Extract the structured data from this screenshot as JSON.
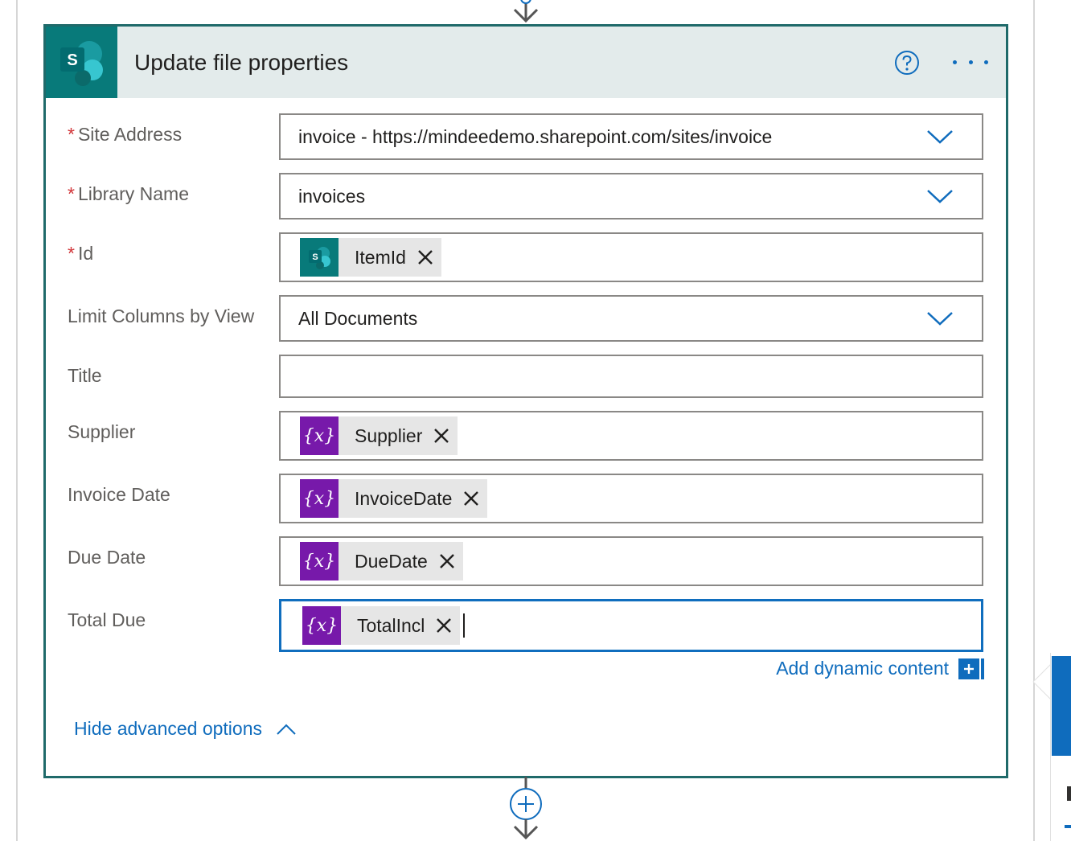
{
  "card": {
    "title": "Update file properties",
    "help_icon": "question-circle-icon",
    "more_icon": "ellipsis-icon",
    "logo_icon": "sharepoint-logo-icon"
  },
  "fields": {
    "site_address": {
      "label": "Site Address",
      "required": true,
      "value": "invoice - https://mindeedemo.sharepoint.com/sites/invoice"
    },
    "library_name": {
      "label": "Library Name",
      "required": true,
      "value": "invoices"
    },
    "id": {
      "label": "Id",
      "required": true,
      "token": "ItemId"
    },
    "limit_columns": {
      "label": "Limit Columns by View",
      "value": "All Documents"
    },
    "title": {
      "label": "Title",
      "value": ""
    },
    "supplier": {
      "label": "Supplier",
      "token": "Supplier"
    },
    "invoice_date": {
      "label": "Invoice Date",
      "token": "InvoiceDate"
    },
    "due_date": {
      "label": "Due Date",
      "token": "DueDate"
    },
    "total_due": {
      "label": "Total Due",
      "token": "TotalIncl"
    }
  },
  "required_marker": "*",
  "variable_glyph": "{x}",
  "add_dynamic_content": "Add dynamic content",
  "hide_advanced": "Hide advanced options",
  "colors": {
    "accent": "#0f6cbd",
    "sharepoint": "#087a7a",
    "variable": "#7719aa",
    "card_border": "#1f6a6a",
    "header_bg": "#e3ebeb",
    "required": "#d13438"
  }
}
